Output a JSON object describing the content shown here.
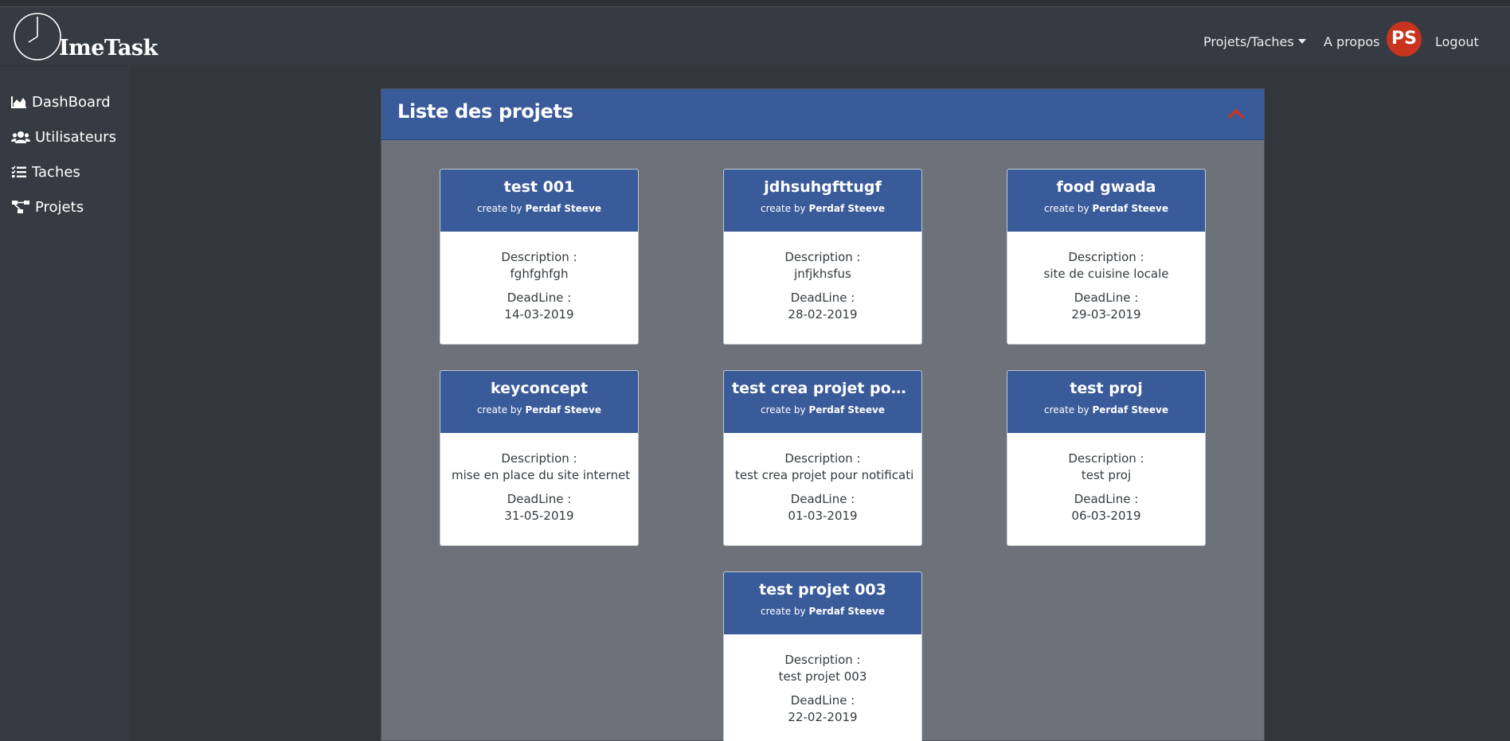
{
  "app": {
    "logo_text": "ImeTask"
  },
  "navbar": {
    "projects_tasks_label": "Projets/Taches",
    "about_label": "A propos",
    "avatar_initials": "PS",
    "logout_label": "Logout"
  },
  "sidebar": {
    "items": [
      {
        "label": "DashBoard",
        "icon": "chart-area-icon"
      },
      {
        "label": "Utilisateurs",
        "icon": "users-icon"
      },
      {
        "label": "Taches",
        "icon": "tasks-icon"
      },
      {
        "label": "Projets",
        "icon": "project-diagram-icon"
      }
    ]
  },
  "panel": {
    "title": "Liste des projets",
    "accent_color": "#3a5b9a",
    "collapse_icon_color": "#c9341f"
  },
  "card_labels": {
    "created_prefix": "create by",
    "description_label": "Description :",
    "deadline_label": "DeadLine :"
  },
  "projects": [
    {
      "title": "test 001",
      "author": "Perdaf Steeve",
      "description": "fghfghfgh",
      "deadline": "14-03-2019"
    },
    {
      "title": "jdhsuhgfttugf",
      "author": "Perdaf Steeve",
      "description": "jnfjkhsfus",
      "deadline": "28-02-2019"
    },
    {
      "title": "food gwada",
      "author": "Perdaf Steeve",
      "description": "site de cuisine locale",
      "deadline": "29-03-2019"
    },
    {
      "title": "keyconcept",
      "author": "Perdaf Steeve",
      "description": "mise en place du site internet",
      "deadline": "31-05-2019"
    },
    {
      "title": "test crea projet pour...",
      "author": "Perdaf Steeve",
      "description": "test crea projet pour notificati",
      "deadline": "01-03-2019"
    },
    {
      "title": "test proj",
      "author": "Perdaf Steeve",
      "description": "test proj",
      "deadline": "06-03-2019"
    },
    {
      "title": "test projet 003",
      "author": "Perdaf Steeve",
      "description": "test projet 003",
      "deadline": "22-02-2019"
    }
  ]
}
